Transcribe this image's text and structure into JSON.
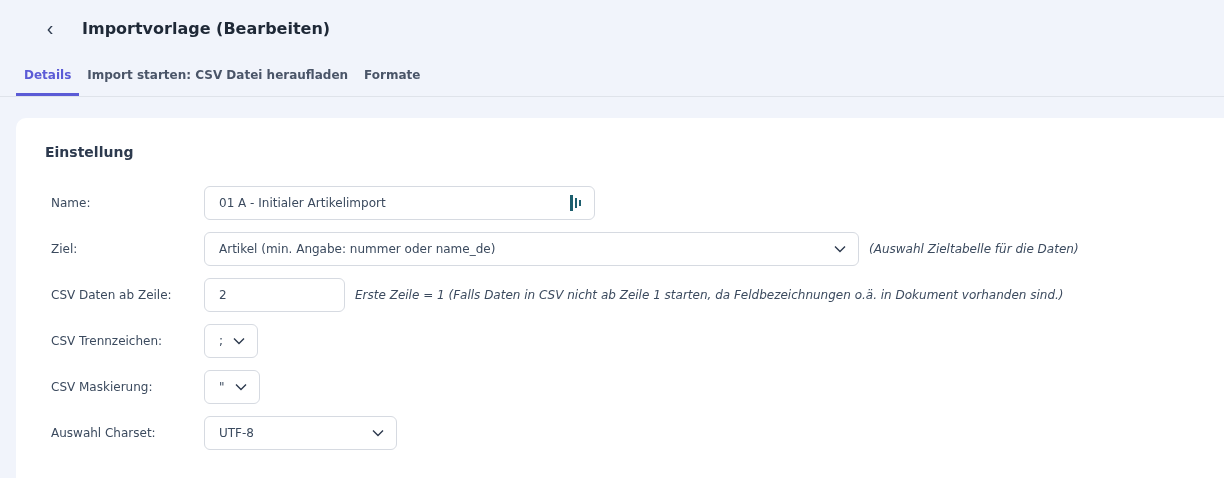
{
  "header": {
    "back": "‹",
    "title": "Importvorlage (Bearbeiten)"
  },
  "tabs": [
    {
      "label": "Details",
      "selected": true
    },
    {
      "label": "Import starten: CSV Datei heraufladen",
      "selected": false
    },
    {
      "label": "Formate",
      "selected": false
    }
  ],
  "section": {
    "title": "Einstellung"
  },
  "fields": [
    {
      "label": "Name:",
      "kind": "text",
      "value": "01 A - Initialer Artikelimport",
      "icon": true
    },
    {
      "label": "Ziel:",
      "kind": "select",
      "value": "Artikel (min. Angabe: nummer oder name_de)",
      "hint": "(Auswahl Zieltabelle für die Daten)"
    },
    {
      "label": "CSV Daten ab Zeile:",
      "kind": "text",
      "value": "2",
      "hint": "Erste Zeile = 1 (Falls Daten in CSV nicht ab Zeile 1 starten, da Feldbezeichnungen o.ä. in Dokument vorhanden sind.)"
    },
    {
      "label": "CSV Trennzeichen:",
      "kind": "select",
      "value": ";"
    },
    {
      "label": "CSV Maskierung:",
      "kind": "select",
      "value": "\""
    },
    {
      "label": "Auswahl Charset:",
      "kind": "select",
      "value": "UTF-8"
    }
  ]
}
